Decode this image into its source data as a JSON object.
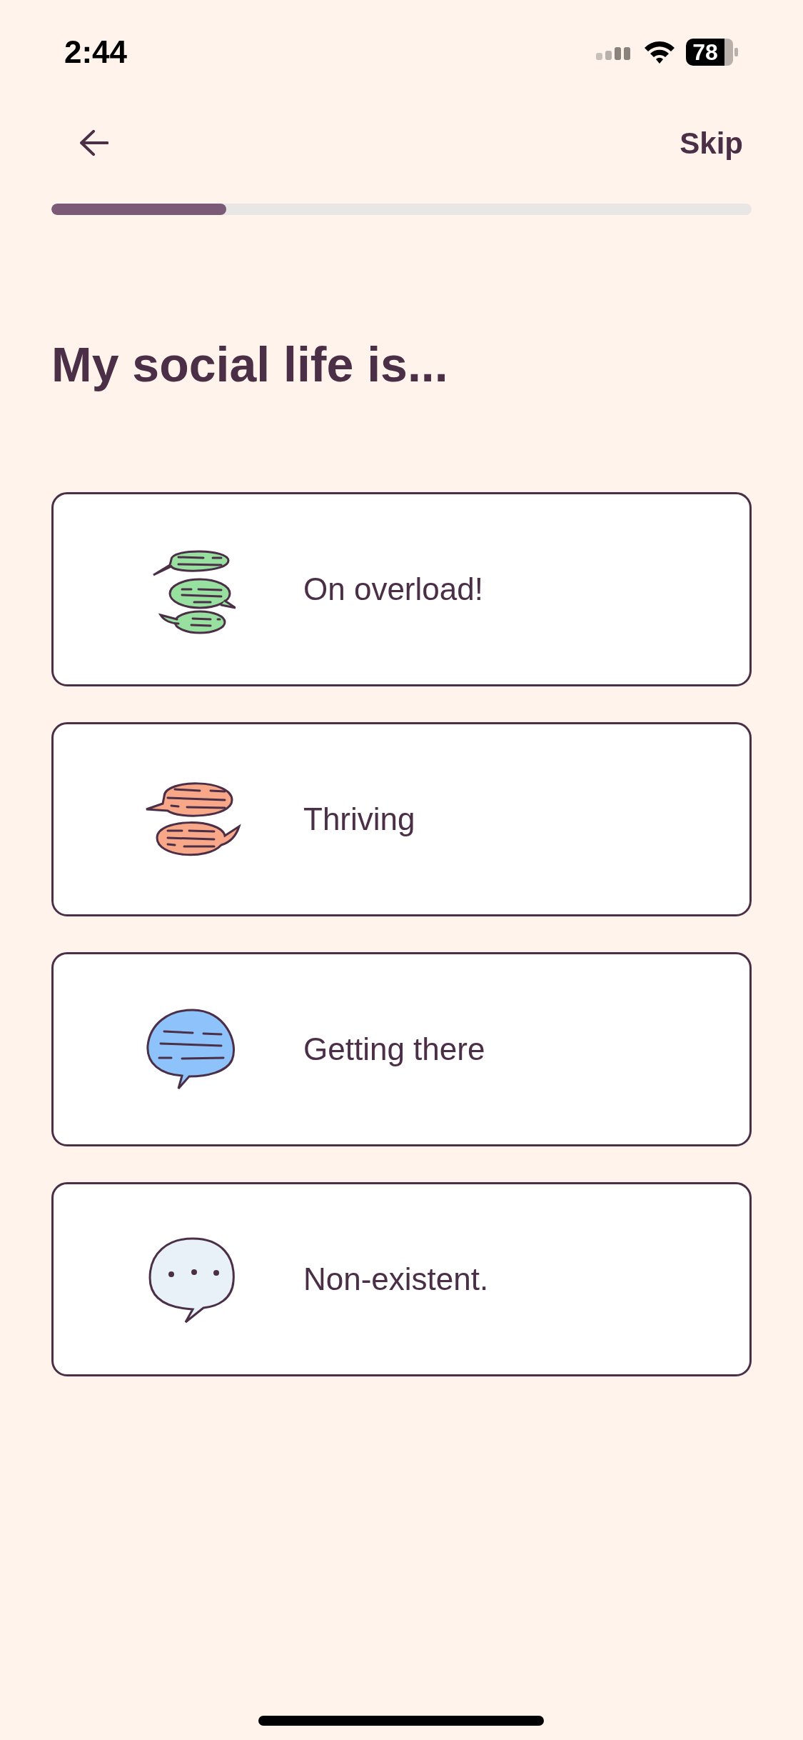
{
  "status_bar": {
    "time": "2:44",
    "battery": "78"
  },
  "nav": {
    "skip": "Skip"
  },
  "progress": {
    "level": 0.25
  },
  "title": "My social life is...",
  "options": [
    {
      "label": "On overload!",
      "kind": "three-bubbles",
      "selected": false
    },
    {
      "label": "Thriving",
      "kind": "two-bubbles",
      "selected": false
    },
    {
      "label": "Getting there",
      "kind": "one-bubble",
      "selected": false
    },
    {
      "label": "Non-existent.",
      "kind": "empty-bubble",
      "selected": false
    }
  ]
}
